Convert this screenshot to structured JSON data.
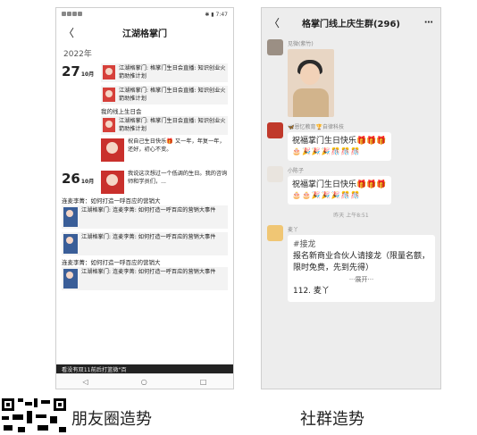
{
  "moments": {
    "title": "江湖格掌门",
    "year": "2022年",
    "day1": {
      "day": "27",
      "month": "10月"
    },
    "day1_posts": [
      {
        "text": "江湖格掌门: 格掌门生日会直播: 知识创业火箭助推计划"
      },
      {
        "text": "江湖格掌门: 格掌门生日会直播: 知识创业火箭助推计划"
      },
      {
        "text": "我的线上生日会"
      },
      {
        "text": "江湖格掌门: 格掌门生日会直播: 知识创业火箭助推计划"
      },
      {
        "text": "祝自己生日快乐🎁 又一年，年复一年，还好，初心不变。"
      }
    ],
    "day2": {
      "day": "26",
      "month": "10月"
    },
    "day2_posts": [
      {
        "text": "我说这次想过一个低调的生日。我的咨询师和学员们，..."
      },
      {
        "text": "连麦李菁：如何打造一呼百应的营销大"
      },
      {
        "text": "江湖格掌门: 连麦李菁: 如何打造一呼百应的营销大事件"
      },
      {
        "text": "江湖格掌门: 连麦李菁: 如何打造一呼百应的营销大事件"
      },
      {
        "text": "连麦李菁：如何打造一呼百应的营销大"
      },
      {
        "text": "江湖格掌门: 连麦李菁: 如何打造一呼百应的营销大事件"
      }
    ],
    "bottom_text": "看没有双11前后打篮微\"百"
  },
  "group": {
    "title": "格掌门线上庆生群(296)",
    "msg1_sender": "见微(紫竹)",
    "msg2_sender": "🦋恩忆教育🏆自律科技",
    "msg2_text": "祝福掌门生日快乐🎁🎁🎁",
    "msg2_emoji": "🎂🎉🎉🎉🎊🎊🎊",
    "msg3_sender": "小陈子",
    "msg3_text": "祝福掌门生日快乐🎁🎁🎁",
    "msg3_emoji": "🎂🎂🎉🎉🎉🎊🎊",
    "time": "昨天 上午8:51",
    "msg4_sender": "麦丫",
    "msg4_tag": "#接龙",
    "msg4_body": "报名新商业合伙人请接龙（限量名额，限时免费，先到先得）",
    "msg4_expand": "···展开···",
    "msg4_entry": "112. 麦丫"
  },
  "captions": {
    "left": "朋友圈造势",
    "right": "社群造势"
  },
  "colors": {
    "red_thumb": "#d6403a",
    "chat_bg": "#ededed"
  }
}
